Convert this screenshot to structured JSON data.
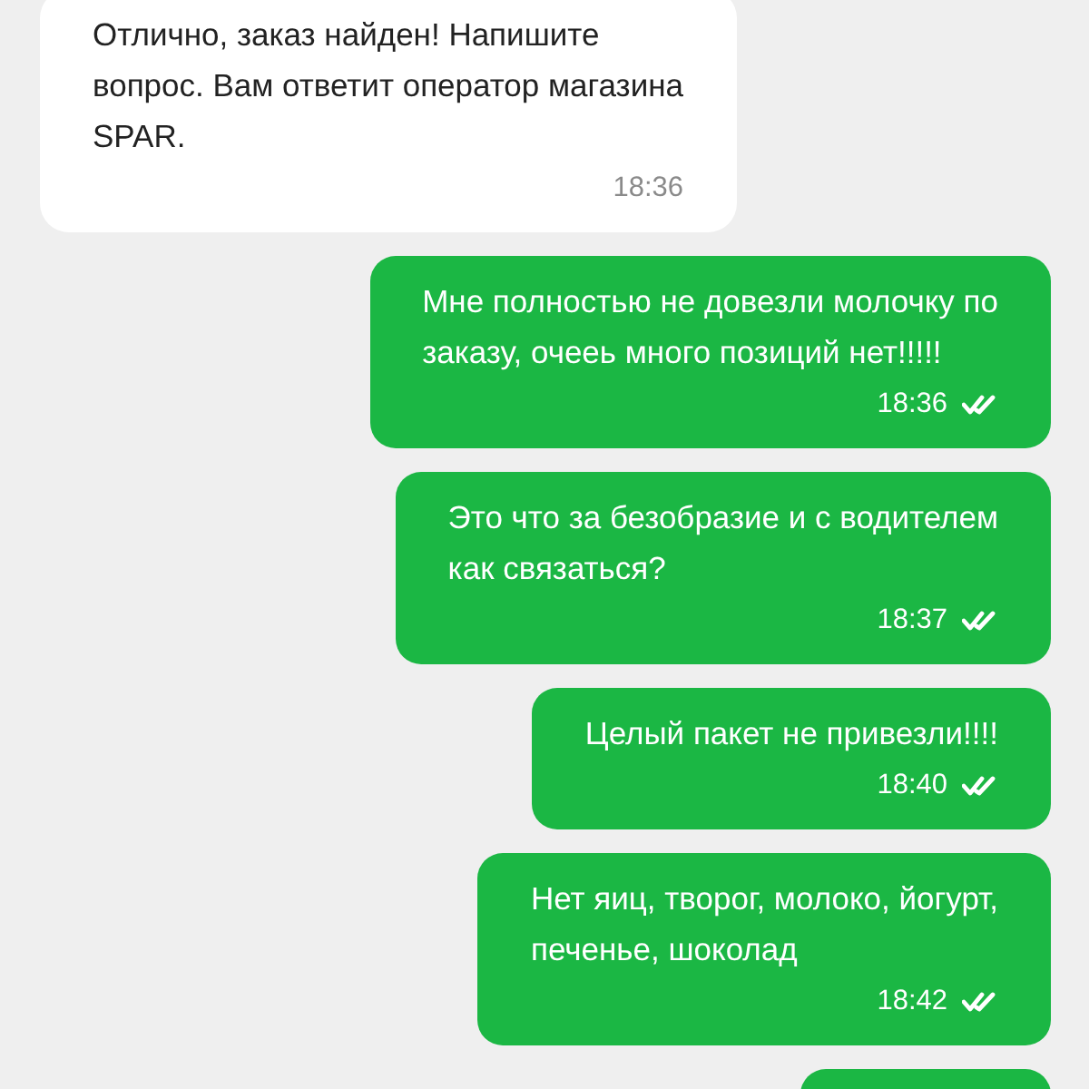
{
  "messages": [
    {
      "kind": "incoming",
      "text": "Отлично, заказ найден! Напишите\nвопрос. Вам ответит оператор магазина\nSPAR.",
      "time": "18:36"
    },
    {
      "kind": "outgoing",
      "text": "Мне полностью не довезли молочку по\nзаказу, очеeь много позиций нет!!!!!",
      "time": "18:36",
      "read": true
    },
    {
      "kind": "outgoing",
      "text": "Это что за безобразие и с водителем\nкак связаться?",
      "time": "18:37",
      "read": true
    },
    {
      "kind": "outgoing",
      "text": "Целый пакет не привезли!!!!",
      "time": "18:40",
      "read": true
    },
    {
      "kind": "outgoing",
      "text": "Нет яиц, творог, молоко, йогурт,\nпеченье, шоколад",
      "time": "18:42",
      "read": true
    }
  ]
}
